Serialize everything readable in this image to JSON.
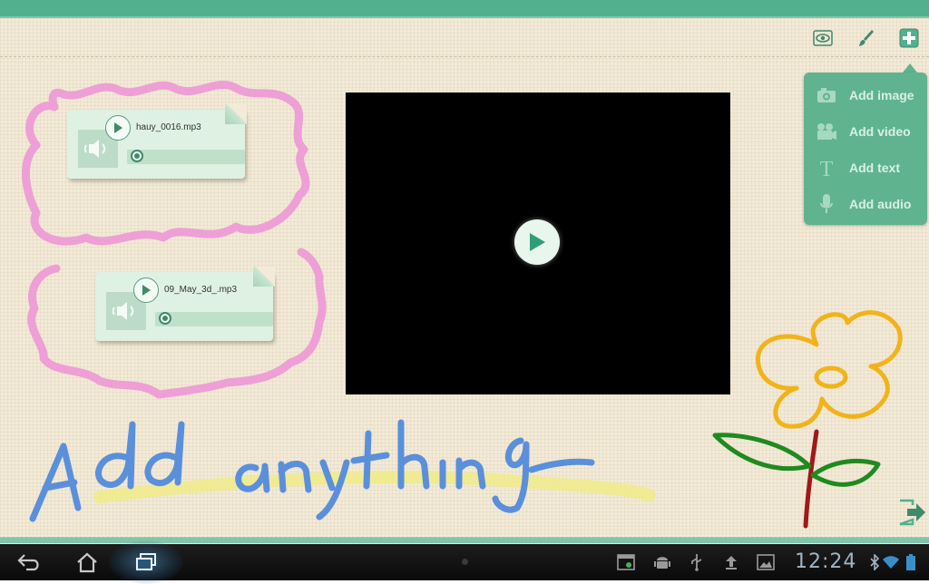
{
  "toolbar": {
    "preview_icon": "eye-icon",
    "brush_icon": "brush-icon",
    "add_icon": "plus-icon"
  },
  "add_menu": {
    "items": [
      {
        "label": "Add image",
        "icon": "camera-icon"
      },
      {
        "label": "Add video",
        "icon": "video-camera-icon"
      },
      {
        "label": "Add text",
        "icon": "text-icon"
      },
      {
        "label": "Add audio",
        "icon": "microphone-icon"
      }
    ]
  },
  "audio_clips": [
    {
      "filename": "hauy_0016.mp3"
    },
    {
      "filename": "09_May_3d_.mp3"
    }
  ],
  "handwriting": "Add anything",
  "statusbar": {
    "clock": "12:24"
  },
  "colors": {
    "accent": "#52b08e",
    "menu_bg": "#5fb48f",
    "paper": "#f3ead7",
    "pink_scribble": "#ee9fd6",
    "blue_ink": "#5a8fdc",
    "yellow_highlight": "#f0eb8a",
    "flower_yellow": "#f2b31a",
    "leaf_green": "#1f8a1f",
    "stem_red": "#a01818"
  }
}
